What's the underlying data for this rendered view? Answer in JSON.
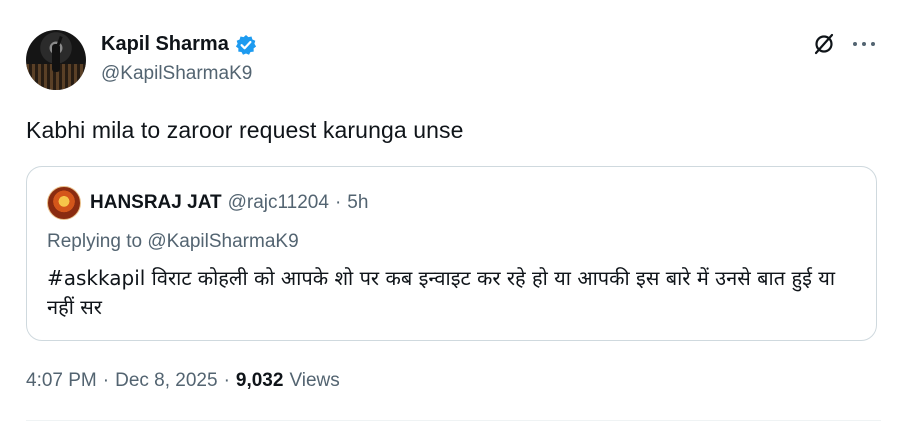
{
  "author": {
    "display_name": "Kapil Sharma",
    "handle": "@KapilSharmaK9",
    "verified_color": "#1d9bf0"
  },
  "tweet": {
    "text": "Kabhi mila to zaroor request karunga unse"
  },
  "quoted": {
    "display_name": "HANSRAJ JAT",
    "handle": "@rajc11204",
    "separator": "·",
    "time": "5h",
    "replying_to": "Replying to @KapilSharmaK9",
    "text": "#askkapil विराट कोहली को आपके शो पर कब इन्वाइट कर रहे हो या आपकी इस बारे में उनसे बात हुई या नहीं सर"
  },
  "meta": {
    "time": "4:07 PM",
    "sep1": "·",
    "date": "Dec 8, 2025",
    "sep2": "·",
    "views_count": "9,032",
    "views_label": "Views"
  },
  "icons": {
    "verified": "verified-badge-icon",
    "grok": "grok-icon",
    "more": "more-icon"
  }
}
